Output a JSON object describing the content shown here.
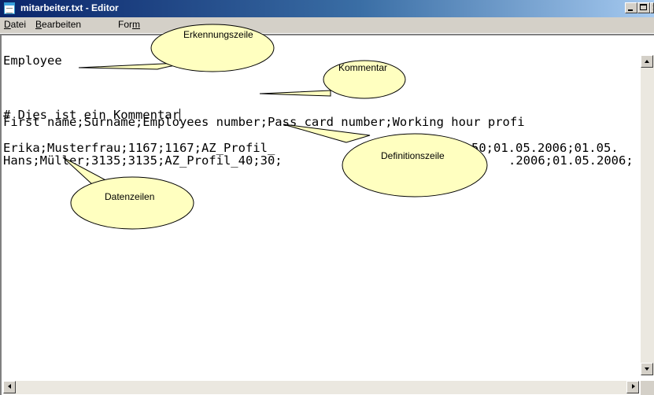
{
  "window": {
    "title": "mitarbeiter.txt - Editor",
    "controls": {
      "minimize_icon": "minimize-icon",
      "maximize_icon": "maximize-icon",
      "close_icon": "close-icon"
    }
  },
  "menu": {
    "datei": {
      "hotkey": "D",
      "rest": "atei"
    },
    "bearbeiten": {
      "hotkey": "B",
      "rest": "earbeiten"
    },
    "format": {
      "pre": "For",
      "hotkey": "m",
      "rest": ""
    }
  },
  "editor": {
    "lines": [
      "Employee",
      "# Dies ist ein Kommentar",
      "First name;Surname;Employees number;Pass card number;Working hour profi",
      "Erika;Musterfrau;1167;1167;AZ_Profil_",
      "Hans;Müller;3135;3135;AZ_Profil_40;30;"
    ],
    "line3_tail": "50;01.05.2006;01.05.",
    "line4_tail": ".2006;01.05.2006;"
  },
  "annotations": {
    "erkennungszeile": "Erkennungszeile",
    "kommentar": "Kommentar",
    "definitionszeile": "Definitionszeile",
    "datenzeilen": "Datenzeilen"
  },
  "colors": {
    "titlebar_start": "#0a246a",
    "titlebar_end": "#a6caf0",
    "callout_fill": "#ffffc0"
  }
}
